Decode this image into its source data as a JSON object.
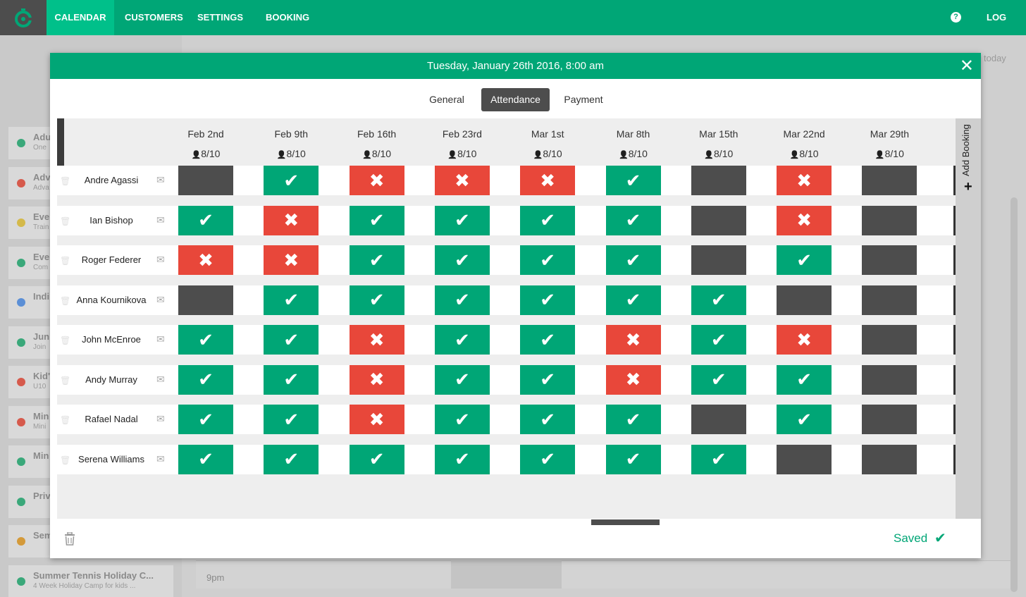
{
  "nav": {
    "items": [
      {
        "label": "CALENDAR",
        "active": true
      },
      {
        "label": "CUSTOMERS",
        "active": false
      },
      {
        "label": "SETTINGS",
        "active": false
      },
      {
        "label": "BOOKING",
        "active": false
      }
    ],
    "help_icon": "question-circle-icon",
    "logout_label": "LOG OUT",
    "accent": "#00a676",
    "logo_bg": "#4d4d4d"
  },
  "background": {
    "sidebar_items": [
      {
        "title": "Adu",
        "sub": "One",
        "color": "#3aa87a"
      },
      {
        "title": "Adv",
        "sub": "Adva",
        "color": "#d65a4c"
      },
      {
        "title": "Eve",
        "sub": "Train",
        "color": "#d4b94a"
      },
      {
        "title": "Eve",
        "sub": "Com",
        "color": "#3aa87a"
      },
      {
        "title": "Indi",
        "sub": "",
        "color": "#5b8fd6"
      },
      {
        "title": "Juni",
        "sub": "Join",
        "color": "#3aa87a"
      },
      {
        "title": "Kid'",
        "sub": "U10",
        "color": "#d65a4c"
      },
      {
        "title": "Min",
        "sub": "Mini",
        "color": "#d65a4c"
      },
      {
        "title": "Min",
        "sub": "",
        "color": "#3aa87a"
      },
      {
        "title": "Priv",
        "sub": "",
        "color": "#3aa87a"
      },
      {
        "title": "Sem",
        "sub": "",
        "color": "#d49a3a"
      },
      {
        "title": "Summer Tennis Holiday C...",
        "sub": "4 Week Holiday Camp for kids ...",
        "color": "#3aa87a"
      }
    ],
    "today_label": "today",
    "time_label": "9pm"
  },
  "modal": {
    "title": "Tuesday, January 26th 2016, 8:00 am",
    "close_icon": "close-icon",
    "tabs": [
      {
        "label": "General",
        "active": false
      },
      {
        "label": "Attendance",
        "active": true
      },
      {
        "label": "Payment",
        "active": false
      }
    ],
    "add_booking_label": "Add Booking",
    "saved_label": "Saved",
    "colors": {
      "present": "#00a676",
      "absent": "#e8473a",
      "none": "#4d4d4d"
    }
  },
  "attendance": {
    "dates": [
      {
        "date": "Feb 2nd",
        "count": "8/10"
      },
      {
        "date": "Feb 9th",
        "count": "8/10"
      },
      {
        "date": "Feb 16th",
        "count": "8/10"
      },
      {
        "date": "Feb 23rd",
        "count": "8/10"
      },
      {
        "date": "Mar 1st",
        "count": "8/10"
      },
      {
        "date": "Mar 8th",
        "count": "8/10"
      },
      {
        "date": "Mar 15th",
        "count": "8/10"
      },
      {
        "date": "Mar 22nd",
        "count": "8/10"
      },
      {
        "date": "Mar 29th",
        "count": "8/10"
      }
    ],
    "rows": [
      {
        "name": "Andre Agassi",
        "cells": [
          "none",
          "present",
          "absent",
          "absent",
          "absent",
          "present",
          "none",
          "absent",
          "none"
        ]
      },
      {
        "name": "Ian Bishop",
        "cells": [
          "present",
          "absent",
          "present",
          "present",
          "present",
          "present",
          "none",
          "absent",
          "none"
        ]
      },
      {
        "name": "Roger Federer",
        "cells": [
          "absent",
          "absent",
          "present",
          "present",
          "present",
          "present",
          "none",
          "present",
          "none"
        ]
      },
      {
        "name": "Anna Kournikova",
        "cells": [
          "none",
          "present",
          "present",
          "present",
          "present",
          "present",
          "present",
          "none",
          "none"
        ]
      },
      {
        "name": "John McEnroe",
        "cells": [
          "present",
          "present",
          "absent",
          "present",
          "present",
          "absent",
          "present",
          "absent",
          "none"
        ]
      },
      {
        "name": "Andy Murray",
        "cells": [
          "present",
          "present",
          "absent",
          "present",
          "present",
          "absent",
          "present",
          "present",
          "none"
        ]
      },
      {
        "name": "Rafael Nadal",
        "cells": [
          "present",
          "present",
          "absent",
          "present",
          "present",
          "present",
          "none",
          "present",
          "none"
        ]
      },
      {
        "name": "Serena Williams",
        "cells": [
          "present",
          "present",
          "present",
          "present",
          "present",
          "present",
          "present",
          "none",
          "none"
        ]
      }
    ]
  }
}
